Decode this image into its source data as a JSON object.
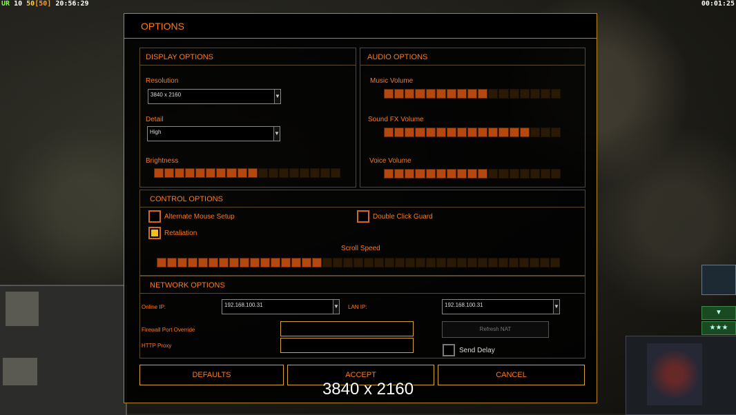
{
  "hud": {
    "tag": "UR",
    "n1": "10",
    "n2": "50",
    "bracket": "[50]",
    "clock": "20:56:29",
    "timer": "00:01:25"
  },
  "dialog": {
    "title": "OPTIONS"
  },
  "display": {
    "header": "DISPLAY OPTIONS",
    "resolution_label": "Resolution",
    "resolution_value": "3840 x 2160",
    "detail_label": "Detail",
    "detail_value": "High",
    "brightness_label": "Brightness",
    "brightness_level": 0.55
  },
  "audio": {
    "header": "AUDIO OPTIONS",
    "music_label": "Music Volume",
    "music_level": 0.6,
    "sfx_label": "Sound FX Volume",
    "sfx_level": 0.8,
    "voice_label": "Voice Volume",
    "voice_level": 0.6
  },
  "control": {
    "header": "CONTROL OPTIONS",
    "alt_mouse_label": "Alternate Mouse Setup",
    "alt_mouse_checked": false,
    "double_click_label": "Double Click Guard",
    "double_click_checked": false,
    "retaliation_label": "Retaliation",
    "retaliation_checked": true,
    "scroll_label": "Scroll Speed",
    "scroll_level": 0.4
  },
  "network": {
    "header": "NETWORK OPTIONS",
    "online_ip_label": "Online IP:",
    "online_ip_value": "192.168.100.31",
    "lan_ip_label": "LAN IP:",
    "lan_ip_value": "192.168.100.31",
    "firewall_label": "Firewall Port Override",
    "http_proxy_label": "HTTP Proxy",
    "refresh_nat_label": "Refresh NAT",
    "send_delay_label": "Send Delay",
    "send_delay_checked": false
  },
  "buttons": {
    "defaults": "DEFAULTS",
    "accept": "ACCEPT",
    "cancel": "CANCEL"
  },
  "overlay_text": "3840 x 2160",
  "colors": {
    "accent": "#ff7a1a",
    "border_gold": "#d9a62a",
    "slider_on": "#b5480f",
    "slider_off": "#2a1a05",
    "check_fill": "#f0c020"
  }
}
